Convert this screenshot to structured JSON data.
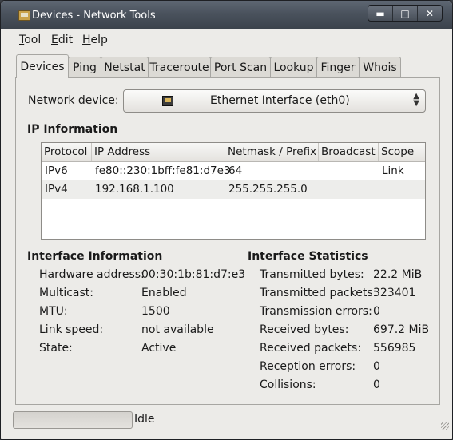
{
  "window": {
    "title": "Devices - Network Tools",
    "controls": {
      "minimize": "▬",
      "maximize": "□",
      "close": "✕"
    }
  },
  "menubar": {
    "items": [
      {
        "mnemonic": "T",
        "rest": "ool"
      },
      {
        "mnemonic": "E",
        "rest": "dit"
      },
      {
        "mnemonic": "H",
        "rest": "elp"
      }
    ]
  },
  "tabs": [
    "Devices",
    "Ping",
    "Netstat",
    "Traceroute",
    "Port Scan",
    "Lookup",
    "Finger",
    "Whois"
  ],
  "active_tab": "Devices",
  "device_selector": {
    "label_mnemonic": "N",
    "label_rest": "etwork device:",
    "selected": "Ethernet Interface (eth0)"
  },
  "ip_information": {
    "title": "IP Information",
    "columns": [
      "Protocol",
      "IP Address",
      "Netmask / Prefix",
      "Broadcast",
      "Scope"
    ],
    "rows": [
      {
        "protocol": "IPv6",
        "address": "fe80::230:1bff:fe81:d7e3",
        "netmask": "64",
        "broadcast": "",
        "scope": "Link"
      },
      {
        "protocol": "IPv4",
        "address": "192.168.1.100",
        "netmask": "255.255.255.0",
        "broadcast": "",
        "scope": ""
      }
    ]
  },
  "interface_information": {
    "title": "Interface Information",
    "items": [
      {
        "label": "Hardware address:",
        "value": "00:30:1b:81:d7:e3"
      },
      {
        "label": "Multicast:",
        "value": "Enabled"
      },
      {
        "label": "MTU:",
        "value": "1500"
      },
      {
        "label": "Link speed:",
        "value": "not available"
      },
      {
        "label": "State:",
        "value": "Active"
      }
    ]
  },
  "interface_statistics": {
    "title": "Interface Statistics",
    "items": [
      {
        "label": "Transmitted bytes:",
        "value": "22.2 MiB"
      },
      {
        "label": "Transmitted packets:",
        "value": "323401"
      },
      {
        "label": "Transmission errors:",
        "value": "0"
      },
      {
        "label": "Received bytes:",
        "value": "697.2 MiB"
      },
      {
        "label": "Received packets:",
        "value": "556985"
      },
      {
        "label": "Reception errors:",
        "value": "0"
      },
      {
        "label": "Collisions:",
        "value": "0"
      }
    ]
  },
  "statusbar": {
    "text": "Idle"
  }
}
